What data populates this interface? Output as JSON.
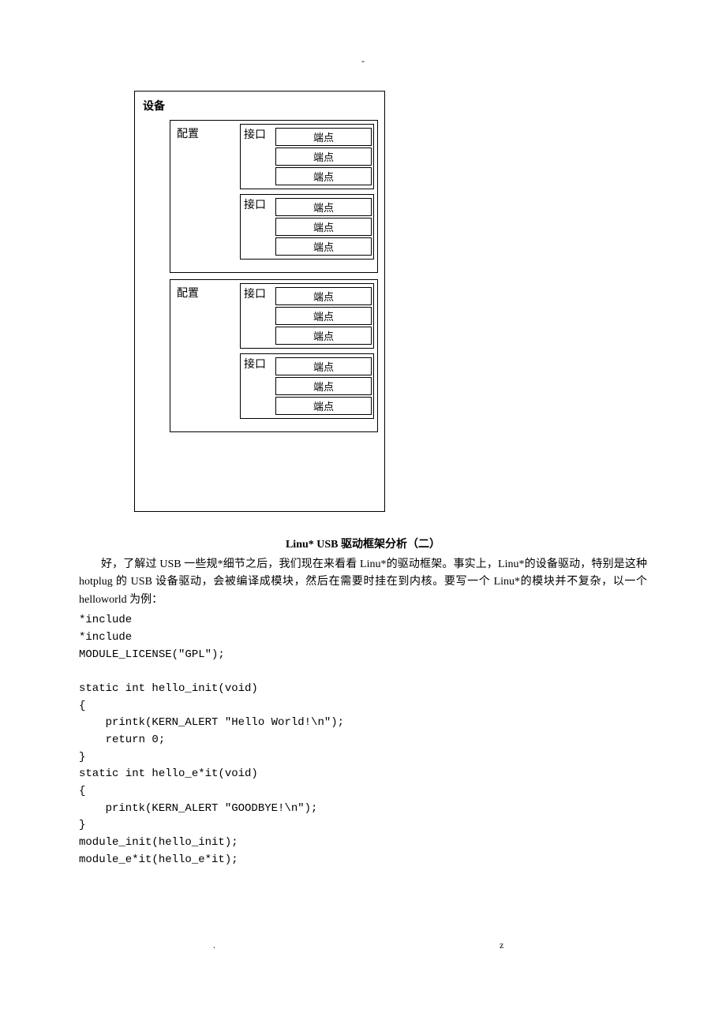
{
  "top_dash": "-",
  "diagram": {
    "device": "设备",
    "config": "配置",
    "iface": "接口",
    "endpoint": "端点"
  },
  "section_title": "Linu* USB 驱动框架分析（二）",
  "para": "好，了解过 USB 一些规*细节之后，我们现在来看看 Linu*的驱动框架。事实上，Linu*的设备驱动，特别是这种 hotplug 的 USB 设备驱动，会被编译成模块，然后在需要时挂在到内核。要写一个 Linu*的模块并不复杂，以一个 helloworld 为例：",
  "code_lines": [
    "*include",
    "*include",
    "MODULE_LICENSE(\"GPL\");",
    "",
    "static int hello_init(void)",
    "{",
    "    printk(KERN_ALERT \"Hello World!\\n\");",
    "    return 0;",
    "}",
    "static int hello_e*it(void)",
    "{",
    "    printk(KERN_ALERT \"GOODBYE!\\n\");",
    "}",
    "module_init(hello_init);",
    "module_e*it(hello_e*it);"
  ],
  "footer": {
    "dot": ".",
    "z": "z"
  }
}
